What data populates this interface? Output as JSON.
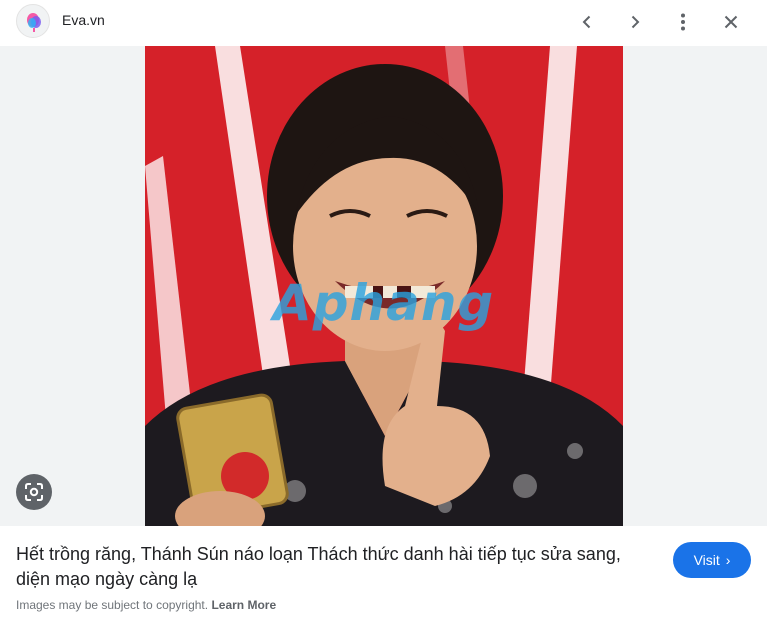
{
  "header": {
    "site_name": "Eva.vn",
    "site_icon": "eva-logo-icon",
    "buttons": [
      {
        "name": "previous",
        "icon": "chevron-left-icon"
      },
      {
        "name": "next",
        "icon": "chevron-right-icon"
      },
      {
        "name": "more",
        "icon": "more-vert-icon"
      },
      {
        "name": "close",
        "icon": "close-icon"
      }
    ]
  },
  "image": {
    "watermark": "Aphang",
    "lens_icon": "lens-search-icon"
  },
  "result": {
    "title": "Hết trồng răng, Thánh Sún náo loạn Thách thức danh hài tiếp tục sửa sang, diện mạo ngày càng lạ",
    "visit_label": "Visit",
    "copyright_text": "Images may be subject to copyright.",
    "learn_more_label": "Learn More"
  },
  "colors": {
    "accent": "#1a73e8",
    "stage_red": "#e0262e",
    "viewer_bg": "#f1f3f4"
  }
}
